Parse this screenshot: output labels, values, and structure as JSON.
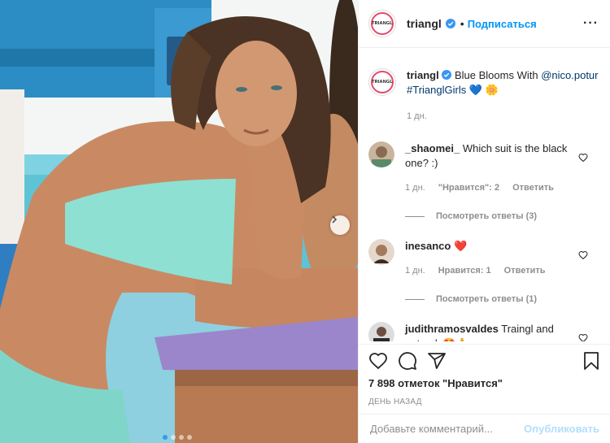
{
  "post": {
    "username": "triangl",
    "follow_label": "Подписаться",
    "separator": "•",
    "avatar_text": "TRIANGL"
  },
  "caption": {
    "username": "triangl",
    "text_before": "Blue Blooms With",
    "mention": "@nico.potur",
    "hashtag": "#TrianglGirls",
    "emoji": "💙 🌼",
    "time": "1 дн."
  },
  "comments": [
    {
      "username": "_shaomei_",
      "text": "Which suit is the black one? :)",
      "time": "1 дн.",
      "likes": "\"Нравится\": 2",
      "reply": "Ответить",
      "view_replies": "Посмотреть ответы (3)"
    },
    {
      "username": "inesanco",
      "text": "❤️",
      "time": "1 дн.",
      "likes": "Нравится: 1",
      "reply": "Ответить",
      "view_replies": "Посмотреть ответы (1)"
    },
    {
      "username": "judithramosvaldes",
      "text": "Traingl and naturals🤩🙏"
    }
  ],
  "likes_count": "7 898 отметок \"Нравится\"",
  "date": "День назад",
  "add_comment": {
    "placeholder": "Добавьте комментарий...",
    "publish": "Опубликовать"
  },
  "carousel": {
    "slides": 4,
    "active": 0
  },
  "colors": {
    "accent": "#0095f6",
    "verified": "#3897f0",
    "muted": "#8e8e8e"
  }
}
